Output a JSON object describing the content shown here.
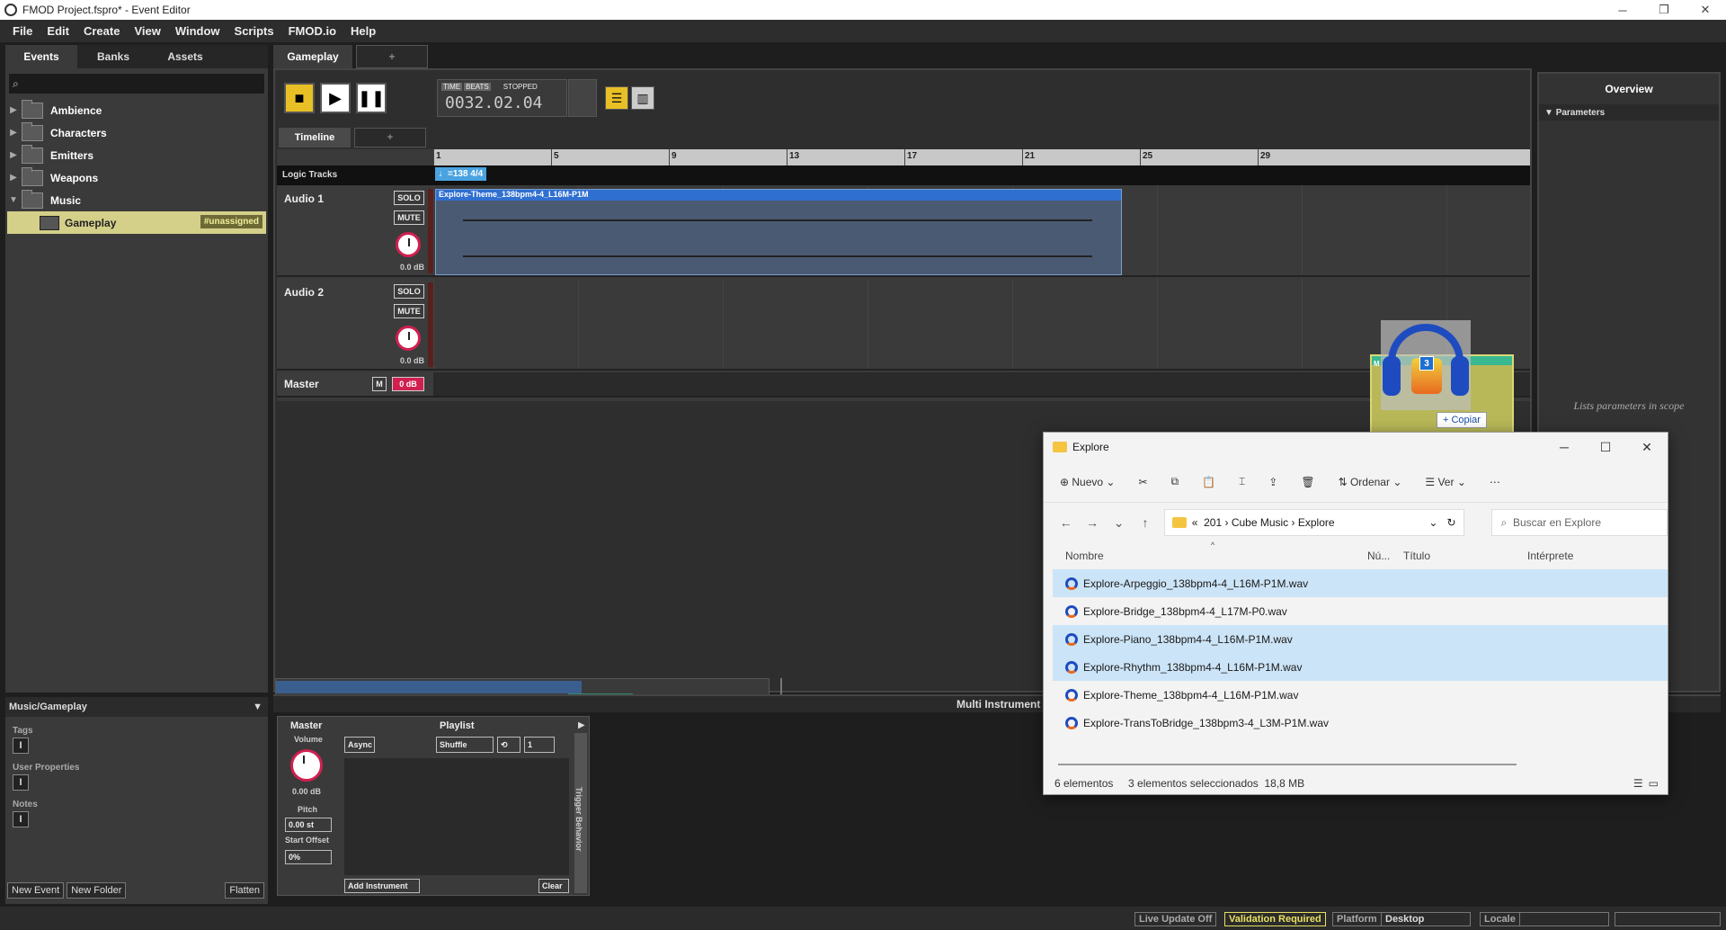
{
  "window": {
    "title": "FMOD Project.fspro* - Event Editor"
  },
  "menu": [
    "File",
    "Edit",
    "Create",
    "View",
    "Window",
    "Scripts",
    "FMOD.io",
    "Help"
  ],
  "left_tabs": [
    "Events",
    "Banks",
    "Assets"
  ],
  "tree": [
    {
      "label": "Ambience",
      "arrow": "▶"
    },
    {
      "label": "Characters",
      "arrow": "▶"
    },
    {
      "label": "Emitters",
      "arrow": "▶"
    },
    {
      "label": "Weapons",
      "arrow": "▶"
    },
    {
      "label": "Music",
      "arrow": "▼"
    }
  ],
  "selected_event": {
    "label": "Gameplay",
    "badge": "#unassigned"
  },
  "left_bottom": {
    "path": "Music/Gameplay",
    "tags": "Tags",
    "user_properties": "User Properties",
    "notes": "Notes",
    "new_event": "New Event",
    "new_folder": "New Folder",
    "flatten": "Flatten"
  },
  "editor": {
    "tab": "Gameplay",
    "transport_state": "STOPPED",
    "time_mode": "TIME",
    "beats_mode": "BEATS",
    "time_display": "0032.02.04",
    "timeline_tab": "Timeline",
    "ruler": [
      "1",
      "5",
      "9",
      "13",
      "17",
      "21",
      "25",
      "29"
    ],
    "logic_tracks": "Logic Tracks",
    "tempo": "♩=138 4/4",
    "tracks": [
      {
        "name": "Audio 1",
        "solo": "SOLO",
        "mute": "MUTE",
        "db": "0.0 dB"
      },
      {
        "name": "Audio 2",
        "solo": "SOLO",
        "mute": "MUTE",
        "db": "0.0 dB"
      }
    ],
    "master": {
      "name": "Master",
      "m": "M",
      "meter": "0 dB"
    },
    "clip": "Explore-Theme_138bpm4-4_L16M-P1M",
    "drop_label": "M",
    "drag_count": "3",
    "copy_hint": "+ Copiar"
  },
  "overview": {
    "title": "Overview",
    "parameters": "Parameters",
    "hint": "Lists parameters in scope"
  },
  "multi": {
    "title": "Multi Instrument",
    "master": "Master",
    "volume": "Volume",
    "volume_value": "0.00 dB",
    "pitch": "Pitch",
    "pitch_value": "0.00 st",
    "start_offset": "Start Offset",
    "start_value": "0%",
    "playlist": "Playlist",
    "async": "Async",
    "shuffle": "Shuffle",
    "count": "1",
    "add_instrument": "Add Instrument",
    "clear": "Clear",
    "trigger": "Trigger Behavior"
  },
  "status": {
    "live_update": "Live Update Off",
    "validation": "Validation Required",
    "platform_label": "Platform",
    "platform_value": "Desktop",
    "locale_label": "Locale"
  },
  "explorer": {
    "title": "Explore",
    "toolbar": {
      "new": "Nuevo",
      "sort": "Ordenar",
      "view": "Ver"
    },
    "breadcrumb": [
      "«",
      "201",
      "Cube Music",
      "Explore"
    ],
    "search_placeholder": "Buscar en Explore",
    "columns": [
      "Nombre",
      "Nú...",
      "Título",
      "Intérprete"
    ],
    "files": [
      {
        "name": "Explore-Arpeggio_138bpm4-4_L16M-P1M.wav",
        "selected": true
      },
      {
        "name": "Explore-Bridge_138bpm4-4_L17M-P0.wav",
        "selected": false
      },
      {
        "name": "Explore-Piano_138bpm4-4_L16M-P1M.wav",
        "selected": true
      },
      {
        "name": "Explore-Rhythm_138bpm4-4_L16M-P1M.wav",
        "selected": true
      },
      {
        "name": "Explore-Theme_138bpm4-4_L16M-P1M.wav",
        "selected": false
      },
      {
        "name": "Explore-TransToBridge_138bpm3-4_L3M-P1M.wav",
        "selected": false
      }
    ],
    "status_count": "6 elementos",
    "status_selected": "3 elementos seleccionados",
    "status_size": "18,8 MB"
  },
  "colors": {
    "accent_yellow": "#e8c025",
    "clip_blue": "#2f6fd0",
    "selection": "#cce4f7"
  }
}
